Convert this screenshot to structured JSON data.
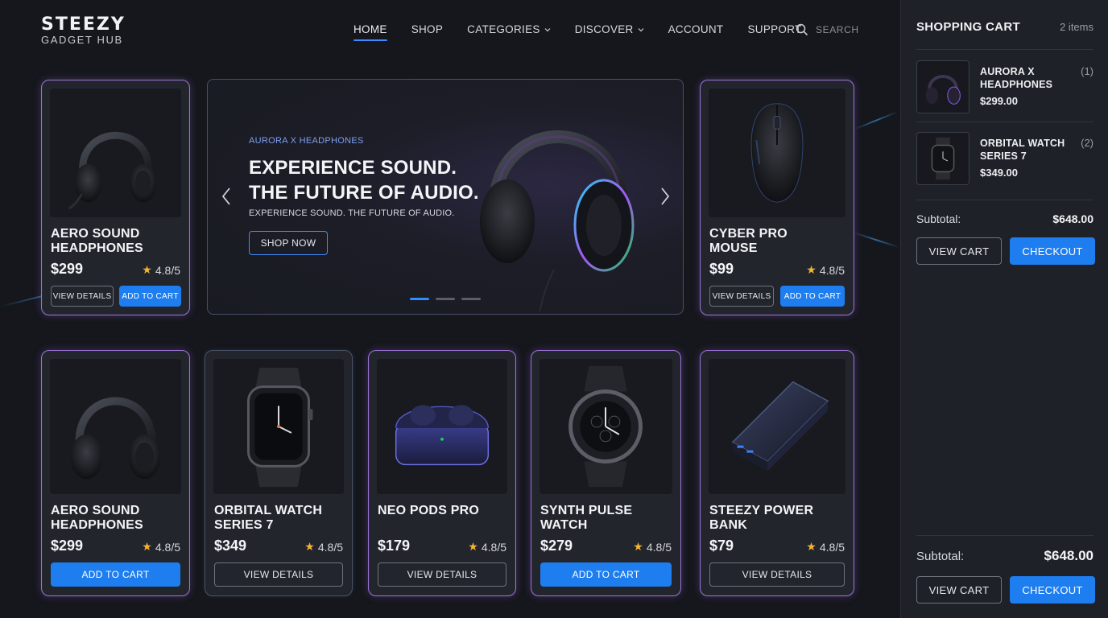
{
  "brand": {
    "name": "STEEZY",
    "tagline": "GADGET HUB"
  },
  "nav": {
    "items": [
      {
        "label": "HOME",
        "active": true,
        "dropdown": false
      },
      {
        "label": "SHOP",
        "active": false,
        "dropdown": false
      },
      {
        "label": "CATEGORIES",
        "active": false,
        "dropdown": true
      },
      {
        "label": "DISCOVER",
        "active": false,
        "dropdown": true
      },
      {
        "label": "ACCOUNT",
        "active": false,
        "dropdown": false
      },
      {
        "label": "SUPPORT",
        "active": false,
        "dropdown": false
      }
    ],
    "search_label": "SEARCH"
  },
  "hero": {
    "kicker": "AURORA X HEADPHONES",
    "headline_line1": "EXPERIENCE SOUND.",
    "headline_line2": "THE FUTURE OF AUDIO.",
    "subtext": "EXPERIENCE SOUND. THE FUTURE OF AUDIO.",
    "cta": "SHOP NOW",
    "slides_total": 3,
    "slide_active": 1
  },
  "featured": [
    {
      "title_line1": "AERO SOUND",
      "title_line2": "HEADPHONES",
      "price": "$299",
      "rating": "4.8/5",
      "btn_details": "VIEW DETAILS",
      "btn_cart": "ADD TO CART",
      "image": "over-ear-headphones"
    },
    {
      "title_line1": "CYBER PRO",
      "title_line2": "MOUSE",
      "price": "$99",
      "rating": "4.8/5",
      "btn_details": "VIEW DETAILS",
      "btn_cart": "ADD TO CART",
      "image": "gaming-mouse"
    }
  ],
  "products": [
    {
      "title_line1": "AERO SOUND",
      "title_line2": "HEADPHONES",
      "price": "$299",
      "rating": "4.8/5",
      "button": "ADD TO CART",
      "button_style": "primary",
      "image": "over-ear-headphones"
    },
    {
      "title_line1": "ORBITAL WATCH",
      "title_line2": "SERIES 7",
      "price": "$349",
      "rating": "4.8/5",
      "button": "VIEW DETAILS",
      "button_style": "outline",
      "image": "smartwatch"
    },
    {
      "title_line1": "NEO PODS PRO",
      "title_line2": "",
      "price": "$179",
      "rating": "4.8/5",
      "button": "VIEW DETAILS",
      "button_style": "outline",
      "image": "earbuds-case"
    },
    {
      "title_line1": "SYNTH PULSE",
      "title_line2": "WATCH",
      "price": "$279",
      "rating": "4.8/5",
      "button": "ADD TO CART",
      "button_style": "primary",
      "image": "sport-watch"
    },
    {
      "title_line1": "STEEZY POWER",
      "title_line2": "BANK",
      "price": "$79",
      "rating": "4.8/5",
      "button": "VIEW DETAILS",
      "button_style": "outline",
      "image": "power-bank"
    }
  ],
  "cart": {
    "title": "SHOPPING CART",
    "count": "2 items",
    "items": [
      {
        "name_line1": "AURORA X",
        "name_line2": "HEADPHONES",
        "qty": "(1)",
        "price": "$299.00",
        "image": "headphones-thumb"
      },
      {
        "name_line1": "ORBITAL WATCH",
        "name_line2": "SERIES 7",
        "qty": "(2)",
        "price": "$349.00",
        "image": "watch-thumb"
      }
    ],
    "subtotal_label": "Subtotal:",
    "subtotal_value": "$648.00",
    "view_cart": "VIEW CART",
    "checkout": "CHECKOUT",
    "footer_subtotal_label": "Subtotal:",
    "footer_subtotal_value": "$648.00",
    "footer_view_cart": "VIEW CART",
    "footer_checkout": "CHECKOUT"
  },
  "colors": {
    "background": "#15171c",
    "card": "#22252c",
    "accent_blue": "#1e7ef0",
    "kicker_blue": "#7f9ff0",
    "star": "#f5b431",
    "card_border_blue": "#5b84c9",
    "card_border_violet": "#9a73d4"
  },
  "icons": {
    "search": "search-icon",
    "nav_dropdown": "chevron-down-icon",
    "hero_prev": "chevron-left-icon",
    "hero_next": "chevron-right-icon",
    "rating": "star-icon"
  }
}
